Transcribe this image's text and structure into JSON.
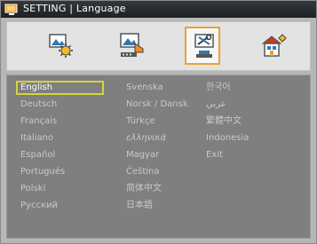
{
  "window": {
    "title": "SETTING | Language"
  },
  "tabs": [
    {
      "icon": "brightness-image-icon",
      "active": false
    },
    {
      "icon": "projector-display-icon",
      "active": false
    },
    {
      "icon": "setting-tools-icon",
      "active": true
    },
    {
      "icon": "options-house-icon",
      "active": false
    }
  ],
  "languages": [
    [
      "English",
      "Deutsch",
      "Français",
      "Italiano",
      "Español",
      "Portugués",
      "Polski",
      "Русский"
    ],
    [
      "Svenska",
      "Norsk / Dansk",
      "Türkçe",
      "ελληνικά",
      "Magyar",
      "Čeština",
      "简体中文",
      "日本語"
    ],
    [
      "한국어",
      "عربي",
      "繁體中文",
      "Indonesia",
      "Exit"
    ]
  ],
  "selected_language": "English",
  "colors": {
    "accent": "#f0a030",
    "selection": "#d4d43a",
    "panel": "#7f7f7f"
  }
}
